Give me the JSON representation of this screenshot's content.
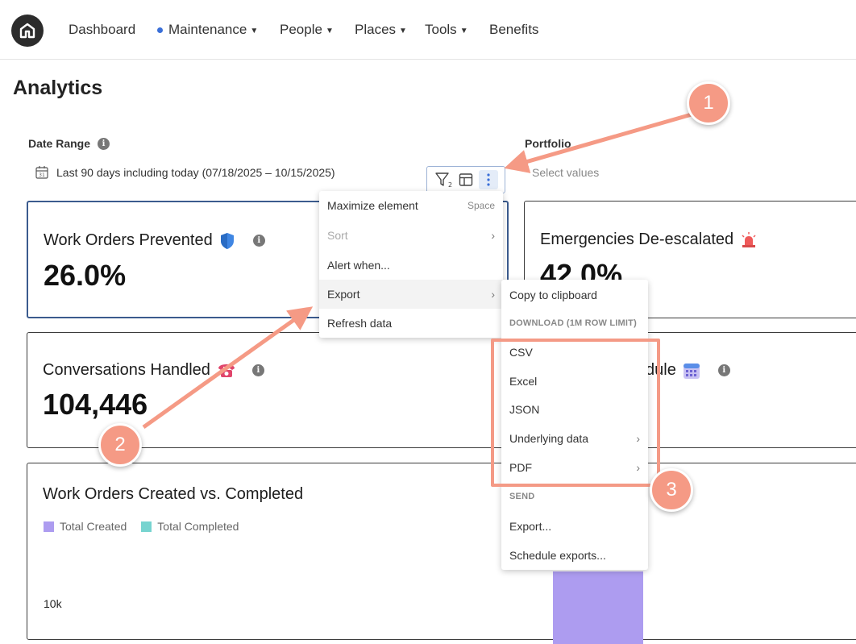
{
  "nav": {
    "items": [
      {
        "label": "Dashboard"
      },
      {
        "label": "Maintenance"
      },
      {
        "label": "People"
      },
      {
        "label": "Places"
      },
      {
        "label": "Tools"
      },
      {
        "label": "Benefits"
      }
    ]
  },
  "page": {
    "title": "Analytics"
  },
  "filters": {
    "date_range_label": "Date Range",
    "date_range_value": "Last 90 days including today (07/18/2025 – 10/15/2025)",
    "portfolio_label": "Portfolio",
    "portfolio_placeholder": "Select values"
  },
  "toolbar": {
    "filter_count": "2"
  },
  "cards": {
    "work_orders": {
      "title": "Work Orders Prevented",
      "value": "26.0%"
    },
    "emergencies": {
      "title": "Emergencies De-escalated",
      "value": "42.0%"
    },
    "conversations": {
      "title": "Conversations Handled",
      "value": "104,446"
    },
    "schedule": {
      "title": "dule"
    }
  },
  "chart_card": {
    "title": "Work Orders Created vs. Completed",
    "legend": [
      {
        "label": "Total Created",
        "color": "#ad9cf0"
      },
      {
        "label": "Total Completed",
        "color": "#77d4d0"
      }
    ],
    "y_tick": "10k"
  },
  "context_menu": {
    "maximize": "Maximize element",
    "maximize_shortcut": "Space",
    "sort": "Sort",
    "alert": "Alert when...",
    "export": "Export",
    "refresh": "Refresh data"
  },
  "export_menu": {
    "copy": "Copy to clipboard",
    "download_header": "DOWNLOAD (1M ROW LIMIT)",
    "csv": "CSV",
    "excel": "Excel",
    "json": "JSON",
    "underlying": "Underlying data",
    "pdf": "PDF",
    "send_header": "SEND",
    "send_export": "Export...",
    "schedule": "Schedule exports..."
  },
  "annotations": {
    "one": "1",
    "two": "2",
    "three": "3"
  },
  "colors": {
    "accent": "#3b5b8e",
    "annotation": "#f59a85",
    "bar": "#ad9cf0"
  }
}
